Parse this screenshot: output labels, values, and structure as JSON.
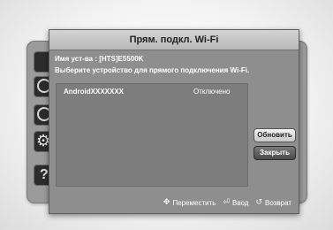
{
  "dialog": {
    "title": "Прям. подкл. Wi-Fi",
    "device_name_line": "Имя уст-ва : [HTS]E5500K",
    "instruction": "Выберите устройство для прямого подключения Wi-Fi."
  },
  "devices": [
    {
      "name": "AndroidXXXXXXX",
      "status": "Отключено"
    }
  ],
  "buttons": {
    "refresh": "Обновить",
    "close": "Закрыть"
  },
  "footer": {
    "move": "Переместить",
    "enter": "Ввод",
    "back": "Возврат"
  },
  "icons": {
    "move": "dpad-icon",
    "enter": "enter-icon",
    "back": "return-icon"
  },
  "colors": {
    "dialog_bg": "#8e8e8e",
    "title_bar": "#d4d4d4",
    "list_bg": "#7d7d7d"
  }
}
